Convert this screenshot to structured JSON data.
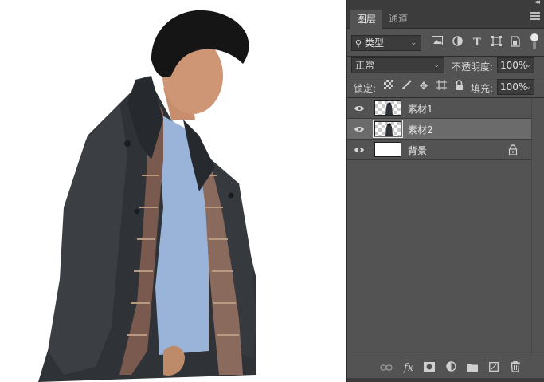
{
  "panel": {
    "collapse": "◂◂",
    "tabs": [
      {
        "label": "图层",
        "active": true
      },
      {
        "label": "通道",
        "active": false
      }
    ],
    "filter": {
      "label": "类型"
    },
    "blend_mode": "正常",
    "opacity_label": "不透明度:",
    "opacity_value": "100%",
    "lock_label": "锁定:",
    "fill_label": "填充:",
    "fill_value": "100%",
    "layers": [
      {
        "name": "素材1",
        "visible": true,
        "selected": false,
        "thumb": "transparent-photo"
      },
      {
        "name": "素材2",
        "visible": true,
        "selected": true,
        "thumb": "transparent-photo"
      },
      {
        "name": "背景",
        "visible": true,
        "selected": false,
        "thumb": "white",
        "locked": true
      }
    ],
    "bottom_fx": "fx"
  },
  "colors": {
    "panel_bg": "#535353",
    "tab_bar_bg": "#3c3c3c",
    "selected_layer": "#6b6b6b",
    "canvas_bg": "#ffffff"
  }
}
